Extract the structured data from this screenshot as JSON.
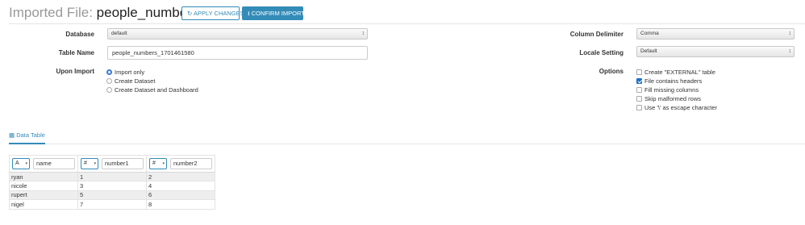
{
  "header": {
    "title_prefix": "Imported File:",
    "file_name": "people_numbers.csv",
    "apply_label": "APPLY CHANGES",
    "confirm_label": "CONFIRM IMPORT"
  },
  "form": {
    "database": {
      "label": "Database",
      "value": "default"
    },
    "table_name": {
      "label": "Table Name",
      "value": "people_numbers_1701461580"
    },
    "upon_import": {
      "label": "Upon Import",
      "options": [
        {
          "label": "Import only",
          "checked": true
        },
        {
          "label": "Create Dataset",
          "checked": false
        },
        {
          "label": "Create Dataset and Dashboard",
          "checked": false
        }
      ]
    },
    "column_delimiter": {
      "label": "Column Delimiter",
      "value": "Comma"
    },
    "locale_setting": {
      "label": "Locale Setting",
      "value": "Default"
    },
    "options": {
      "label": "Options",
      "items": [
        {
          "label": "Create \"EXTERNAL\" table",
          "checked": false
        },
        {
          "label": "File contains headers",
          "checked": true
        },
        {
          "label": "Fill missing columns",
          "checked": false
        },
        {
          "label": "Skip malformed rows",
          "checked": false
        },
        {
          "label": "Use '\\' as escape character",
          "checked": false
        }
      ]
    }
  },
  "tabs": {
    "data_table": "Data Table"
  },
  "table": {
    "columns": [
      {
        "type_glyph": "A",
        "name": "name"
      },
      {
        "type_glyph": "#",
        "name": "number1"
      },
      {
        "type_glyph": "#",
        "name": "number2"
      }
    ],
    "rows": [
      [
        "ryan",
        "1",
        "2"
      ],
      [
        "nicole",
        "3",
        "4"
      ],
      [
        "rupert",
        "5",
        "6"
      ],
      [
        "nigel",
        "7",
        "8"
      ]
    ]
  },
  "colors": {
    "accent": "#338bb8",
    "check": "#1e6fd0"
  }
}
